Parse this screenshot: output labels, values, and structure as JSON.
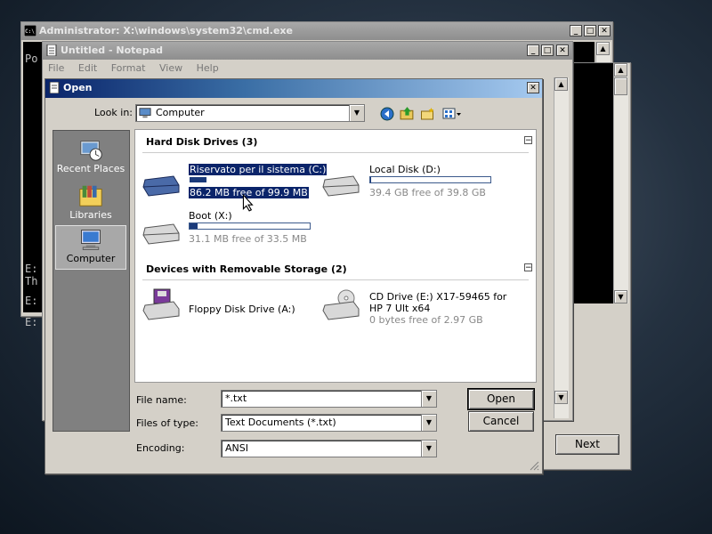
{
  "cmd_window": {
    "title": "Administrator: X:\\windows\\system32\\cmd.exe",
    "lines": [
      "Po",
      "E:",
      "Th",
      "E:",
      "E:"
    ]
  },
  "notepad": {
    "title": "Untitled - Notepad",
    "menu": [
      "File",
      "Edit",
      "Format",
      "View",
      "Help"
    ]
  },
  "setup_window": {
    "next_label": "Next"
  },
  "dialog": {
    "title": "Open",
    "look_in_label": "Look in:",
    "look_in_value": "Computer",
    "places": [
      {
        "label": "Recent Places",
        "icon": "recent-places-icon"
      },
      {
        "label": "Libraries",
        "icon": "libraries-icon"
      },
      {
        "label": "Computer",
        "icon": "computer-icon"
      }
    ],
    "hard_disks_header": "Hard Disk Drives (3)",
    "removable_header": "Devices with Removable Storage (2)",
    "drives": [
      {
        "name": "Riservato per il sistema (C:)",
        "free": "86.2 MB free of 99.9 MB",
        "used_fraction": 0.14,
        "selected": true
      },
      {
        "name": "Local Disk (D:)",
        "free": "39.4 GB free of 39.8 GB",
        "used_fraction": 0.01
      },
      {
        "name": "Boot (X:)",
        "free": "31.1 MB free of 33.5 MB",
        "used_fraction": 0.07
      }
    ],
    "removable": [
      {
        "name": "Floppy Disk Drive (A:)"
      },
      {
        "name_line1": "CD Drive (E:) X17-59465 for",
        "name_line2": "HP 7 Ult x64",
        "free": "0 bytes free of 2.97 GB"
      }
    ],
    "file_name_label": "File name:",
    "file_name_value": "*.txt",
    "files_of_type_label": "Files of type:",
    "files_of_type_value": "Text Documents (*.txt)",
    "encoding_label": "Encoding:",
    "encoding_value": "ANSI",
    "open_label": "Open",
    "cancel_label": "Cancel"
  },
  "colors": {
    "selection": "#0a246a",
    "title_active": "#0a246a",
    "dialog_bg": "#d4d0c8"
  }
}
